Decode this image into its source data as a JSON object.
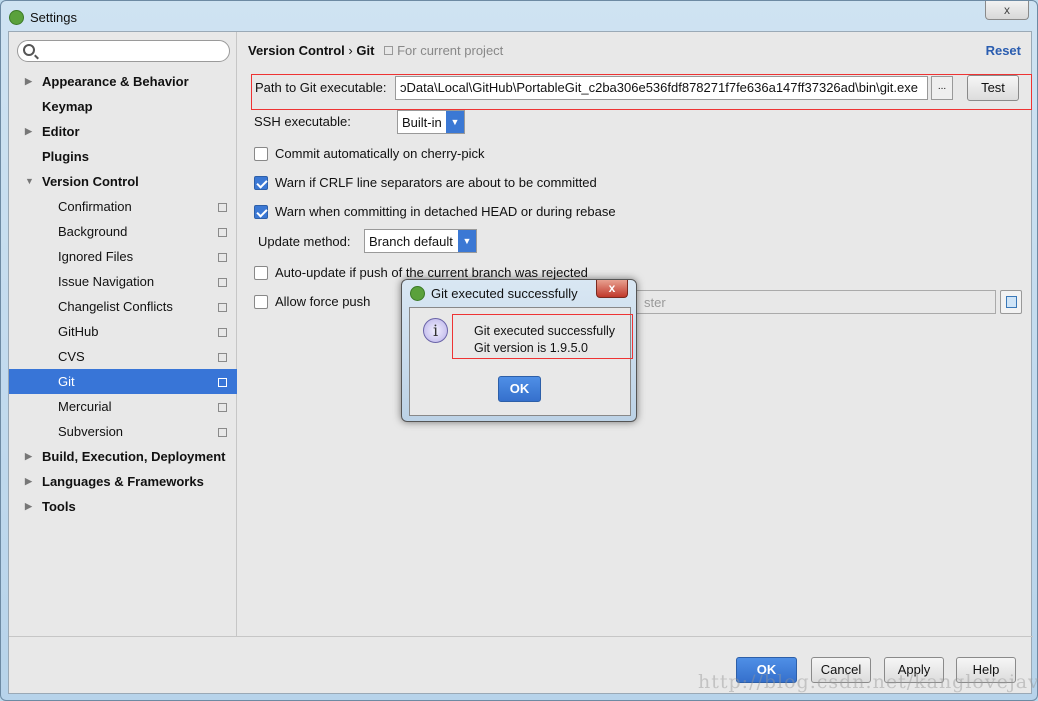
{
  "window": {
    "title": "Settings",
    "close": "x"
  },
  "search": {
    "placeholder": ""
  },
  "sidebar": {
    "items": [
      {
        "label": "Appearance & Behavior",
        "level": "top",
        "arrow": "▶"
      },
      {
        "label": "Keymap",
        "level": "top",
        "arrow": ""
      },
      {
        "label": "Editor",
        "level": "top",
        "arrow": "▶"
      },
      {
        "label": "Plugins",
        "level": "top",
        "arrow": ""
      },
      {
        "label": "Version Control",
        "level": "top",
        "arrow": "▼"
      },
      {
        "label": "Confirmation",
        "level": "sub"
      },
      {
        "label": "Background",
        "level": "sub"
      },
      {
        "label": "Ignored Files",
        "level": "sub"
      },
      {
        "label": "Issue Navigation",
        "level": "sub"
      },
      {
        "label": "Changelist Conflicts",
        "level": "sub"
      },
      {
        "label": "GitHub",
        "level": "sub"
      },
      {
        "label": "CVS",
        "level": "sub"
      },
      {
        "label": "Git",
        "level": "sub",
        "selected": true
      },
      {
        "label": "Mercurial",
        "level": "sub"
      },
      {
        "label": "Subversion",
        "level": "sub"
      },
      {
        "label": "Build, Execution, Deployment",
        "level": "top",
        "arrow": "▶"
      },
      {
        "label": "Languages & Frameworks",
        "level": "top",
        "arrow": "▶"
      },
      {
        "label": "Tools",
        "level": "top",
        "arrow": "▶"
      }
    ]
  },
  "main": {
    "breadcrumb": {
      "parent": "Version Control",
      "sep": "›",
      "current": "Git",
      "scope": "For current project"
    },
    "reset": "Reset",
    "path_label": "Path to Git executable:",
    "path_value": "ɔData\\Local\\GitHub\\PortableGit_c2ba306e536fdf878271f7fe636a147ff37326ad\\bin\\git.exe",
    "browse": "...",
    "test": "Test",
    "ssh_label": "SSH executable:",
    "ssh_value": "Built-in",
    "cherry_pick": {
      "label": "Commit automatically on cherry-pick",
      "checked": false
    },
    "crlf": {
      "label": "Warn if CRLF line separators are about to be committed",
      "checked": true
    },
    "detached": {
      "label": "Warn when committing in detached HEAD or during rebase",
      "checked": true
    },
    "update_label": "Update method:",
    "update_value": "Branch default",
    "auto_update": {
      "label": "Auto-update if push of the current branch was rejected",
      "checked": false
    },
    "force_push": {
      "label": "Allow force push",
      "checked": false
    },
    "protected_placeholder": "ster"
  },
  "footer": {
    "ok": "OK",
    "cancel": "Cancel",
    "apply": "Apply",
    "help": "Help"
  },
  "watermark": "http://blog.csdn.net/kanglovejava",
  "dialog": {
    "title": "Git executed successfully",
    "close": "x",
    "line1": "Git executed successfully",
    "line2": "Git version is 1.9.5.0",
    "ok": "OK"
  },
  "colors": {
    "accent": "#3875d7",
    "highlight": "#e33333"
  }
}
